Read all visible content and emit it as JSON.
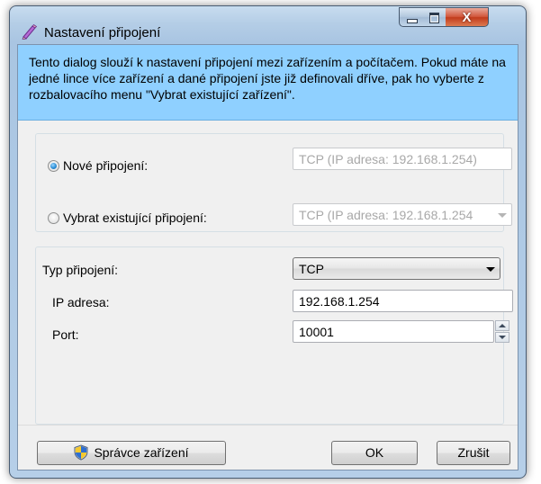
{
  "window": {
    "title": "Nastavení připojení",
    "close_glyph": "X"
  },
  "info_text": "Tento dialog slouží k nastavení připojení mezi zařízením a počítačem. Pokud máte na jedné lince více zařízení a dané připojení jste již definovali dříve, pak ho vyberte z rozbalovacího menu \"Vybrat existující zařízení\".",
  "connection_choice": {
    "new_label": "Nové připojení:",
    "new_value": "TCP (IP adresa: 192.168.1.254)",
    "existing_label": "Vybrat existující připojení:",
    "existing_value": "TCP (IP adresa: 192.168.1.254",
    "selected": "new"
  },
  "settings": {
    "type_label": "Typ připojení:",
    "type_value": "TCP",
    "ip_label": "IP adresa:",
    "ip_value": "192.168.1.254",
    "port_label": "Port:",
    "port_value": "10001"
  },
  "buttons": {
    "device_manager": "Správce zařízení",
    "ok": "OK",
    "cancel": "Zrušit"
  },
  "colors": {
    "info_background": "#8fd0ff",
    "title_bar": "#b4cde6",
    "close_button": "#c13b1c"
  },
  "icons": {
    "window": "pen-icon",
    "device_manager": "uac-shield-icon"
  }
}
